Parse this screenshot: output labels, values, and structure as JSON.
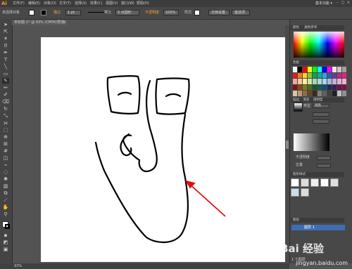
{
  "app": {
    "logo": "Ai",
    "workspace": "基本功能 ▾"
  },
  "menu": [
    "文件(F)",
    "编辑(E)",
    "对象(O)",
    "文字(T)",
    "选择(S)",
    "效果(C)",
    "视图(V)",
    "窗口(W)",
    "帮助(H)"
  ],
  "controlbar": {
    "selection_label": "未选择对象",
    "stroke_label": "描边",
    "stroke_weight": "1 pt",
    "stroke_profile": "等比",
    "brush": "5 点圆形",
    "opacity_label": "不透明度",
    "opacity_value": "100%",
    "style_label": "样式",
    "doc_setup": "文档设置",
    "preferences": "首选项"
  },
  "document": {
    "tab_title": "未标题-1* @ 93% (CMYK/预览)",
    "close": "×"
  },
  "panels": {
    "color_tab": "颜色",
    "color_ref_tab": "颜色参考",
    "swatches_tab": "色板",
    "stroke_tab": "描边",
    "gradient_tab": "渐变",
    "transparency_tab": "透明度",
    "gradient_type_label": "类型",
    "gradient_type": "线性",
    "opacity_label": "不透明度",
    "position_label": "位置",
    "graphic_styles_tab": "图形样式",
    "layers_tab": "图层",
    "layer_name": "图层 1",
    "layers_count": "1 个图层"
  },
  "statusbar": {
    "zoom": "93%"
  },
  "swatch_colors": [
    "#ffffff",
    "#000000",
    "#ff0000",
    "#ffff00",
    "#00ff00",
    "#00ffff",
    "#0000ff",
    "#ff00ff",
    "#e8e8e8",
    "#c8c8c8",
    "#a0a0a0",
    "#e41c1c",
    "#f57c1f",
    "#f9d71c",
    "#8cc63f",
    "#1aa24b",
    "#1aa79b",
    "#29a8e0",
    "#2b5fab",
    "#6a3c97",
    "#c4248f",
    "#e7237c",
    "#f2a6a6",
    "#f9c89b",
    "#fdf0a0",
    "#cfe7a6",
    "#a5d8b2",
    "#a6dcd6",
    "#a6d6f2",
    "#a6b8dc",
    "#c4b0d8",
    "#e6b0d4",
    "#f4b0c8",
    "#7a1414",
    "#8a4a14",
    "#8a7814",
    "#4a6e1c",
    "#14582c",
    "#145a54",
    "#144a78",
    "#142e5c",
    "#3a1e54",
    "#6a1450",
    "#7a1442",
    "#d9c7a8",
    "#b89c74",
    "#8c6c48",
    "#64482c",
    "#3c2a18",
    "#808080",
    "#606060",
    "#404040",
    "#202020",
    "#c0c0c0",
    "#909090"
  ],
  "watermark": {
    "text": "Bai 经验",
    "url": "jingyan.baidu.com"
  }
}
